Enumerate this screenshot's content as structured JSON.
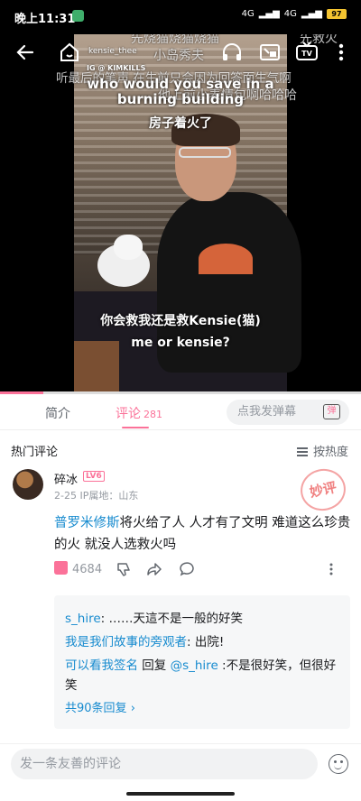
{
  "status_bar": {
    "time": "晚上11:31",
    "signal_1": "4G",
    "signal_2": "4G",
    "battery": "97"
  },
  "video": {
    "danmaku": [
      "先烧猫烧猫烧猫",
      "先救火",
      "小岛秀夫",
      "听最后的笔声 在生前只会因为回答而生气啊",
      "他上前小表情包啊哈哈哈"
    ],
    "watermark_handle": "kensie_thee",
    "watermark_brand": "IG @ KIMKILLS",
    "subtitle_en_top": "who would you save in a burning building",
    "subtitle_zh_top": "房子着火了",
    "subtitle_zh_bottom": "你会救我还是救Kensie(猫)",
    "subtitle_en_bottom": "me or kensie?",
    "progress": 0.12
  },
  "tabs": {
    "intro": "简介",
    "comments": "评论",
    "comments_count": "281",
    "danmu_placeholder": "点我发弹幕",
    "danmu_button": "弹"
  },
  "comments": {
    "section_title": "热门评论",
    "sort_label": "按热度",
    "top": {
      "username": "碎冰",
      "level": "LV6",
      "meta": "2-25 IP属地：山东",
      "stamp": "妙评",
      "mention": "普罗米修斯",
      "text": "将火给了人 人才有了文明 难道这么珍贵的火 就没人选救火吗",
      "likes": "4684"
    },
    "replies": [
      {
        "name": "s_hire",
        "sep": ": ",
        "text": "……天這不是一般的好笑"
      },
      {
        "name": "我是我们故事的旁观者",
        "sep": ": ",
        "text": "出院!"
      },
      {
        "name": "可以看我签名",
        "pre": " 回复 ",
        "target": "@s_hire",
        "sep": " :",
        "text": "不是很好笑，但很好笑"
      }
    ],
    "more_replies": "共90条回复"
  },
  "bottom": {
    "placeholder": "发一条友善的评论"
  }
}
